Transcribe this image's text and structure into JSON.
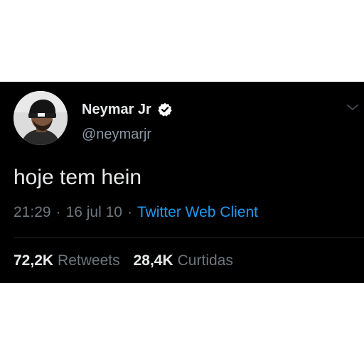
{
  "tweet": {
    "author": {
      "display_name": "Neymar Jr",
      "handle": "@neymarjr",
      "verified": true,
      "avatar_icon": "profile-photo"
    },
    "text": "hoje tem hein",
    "time": "21:29",
    "separator": "·",
    "date": "16 jul 10",
    "source": "Twitter Web Client",
    "stats": {
      "retweets_count": "72,2K",
      "retweets_label": "Retweets",
      "likes_count": "28,4K",
      "likes_label": "Curtidas"
    },
    "menu_icon": "chevron-down-icon"
  },
  "colors": {
    "background": "#000000",
    "text_primary": "#e7e9ea",
    "text_secondary": "#6e767d",
    "link": "#1d9bf0",
    "verified_badge": "#ffffff"
  }
}
